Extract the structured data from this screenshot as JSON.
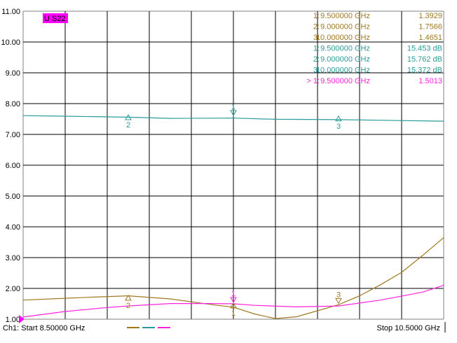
{
  "chart_data": {
    "type": "line",
    "trace_label": "U S22",
    "x_range_ghz": [
      8.5,
      10.5
    ],
    "ylim": [
      1.0,
      11.0
    ],
    "y_ticks": [
      "11.00",
      "10.00",
      "9.00",
      "8.00",
      "7.00",
      "6.00",
      "5.00",
      "4.00",
      "3.00",
      "2.00",
      "1.00"
    ],
    "grid": true,
    "legend_position": "top-right",
    "colors": {
      "brown": "#a07820",
      "teal": "#2a9c98",
      "magenta": "#ff22dd",
      "badge_bg": "#ff00ff",
      "grid": "#000000",
      "border": "#808080"
    },
    "series": [
      {
        "color_key": "brown",
        "x": [
          8.5,
          8.7,
          8.8,
          9.0,
          9.2,
          9.4,
          9.5,
          9.6,
          9.7,
          9.8,
          10.0,
          10.1,
          10.2,
          10.3,
          10.4,
          10.5
        ],
        "y": [
          1.62,
          1.68,
          1.71,
          1.76,
          1.66,
          1.47,
          1.39,
          1.17,
          1.02,
          1.08,
          1.47,
          1.76,
          2.12,
          2.52,
          3.07,
          3.65
        ]
      },
      {
        "color_key": "teal",
        "x": [
          8.5,
          8.7,
          9.0,
          9.2,
          9.5,
          9.7,
          10.0,
          10.2,
          10.5
        ],
        "y": [
          7.61,
          7.59,
          7.56,
          7.52,
          7.53,
          7.49,
          7.48,
          7.46,
          7.43
        ]
      },
      {
        "color_key": "magenta",
        "x": [
          8.5,
          8.7,
          8.9,
          9.0,
          9.2,
          9.4,
          9.5,
          9.6,
          9.8,
          10.0,
          10.2,
          10.4,
          10.5
        ],
        "y": [
          1.07,
          1.25,
          1.38,
          1.43,
          1.51,
          1.51,
          1.5,
          1.45,
          1.4,
          1.43,
          1.62,
          1.88,
          2.1
        ]
      }
    ],
    "markers": [
      {
        "label": "1",
        "x": 9.5,
        "y": 7.57,
        "color_key": "teal",
        "shape": "down",
        "label_pos": "above"
      },
      {
        "label": "2",
        "x": 9.0,
        "y": 7.5,
        "color_key": "teal",
        "shape": "up",
        "label_pos": "below"
      },
      {
        "label": "3",
        "x": 10.0,
        "y": 7.46,
        "color_key": "teal",
        "shape": "up",
        "label_pos": "below"
      },
      {
        "label": "2",
        "x": 9.0,
        "y": 1.64,
        "color_key": "brown",
        "shape": "up",
        "label_pos": "below"
      },
      {
        "label": "1",
        "x": 9.5,
        "y": 1.39,
        "color_key": "brown",
        "shape": "up",
        "label_pos": "below"
      },
      {
        "label": "3",
        "x": 10.0,
        "y": 1.47,
        "color_key": "brown",
        "shape": "down",
        "label_pos": "above"
      },
      {
        "label": "1",
        "x": 9.5,
        "y": 1.5,
        "color_key": "magenta",
        "shape": "down",
        "label_pos": "above"
      }
    ],
    "marker_table": [
      {
        "idx": "1:",
        "freq": "9.500000 GHz",
        "val": "1.3929",
        "color_key": "brown"
      },
      {
        "idx": "2:",
        "freq": "9.000000 GHz",
        "val": "1.7566",
        "color_key": "brown"
      },
      {
        "idx": "3:",
        "freq": "10.000000 GHz",
        "val": "1.4651",
        "color_key": "brown"
      },
      {
        "idx": "1:",
        "freq": "9.500000 GHz",
        "val": "15.453 dB",
        "color_key": "teal"
      },
      {
        "idx": "2:",
        "freq": "9.000000 GHz",
        "val": "15.762 dB",
        "color_key": "teal"
      },
      {
        "idx": "3:",
        "freq": "10.000000 GHz",
        "val": "15.372 dB",
        "color_key": "teal"
      },
      {
        "idx": "> 1:",
        "freq": "9.500000 GHz",
        "val": "1.5013",
        "color_key": "magenta"
      }
    ],
    "footer": {
      "start": "Ch1: Start  8.50000 GHz",
      "stop": "Stop  10.5000 GHz"
    }
  }
}
